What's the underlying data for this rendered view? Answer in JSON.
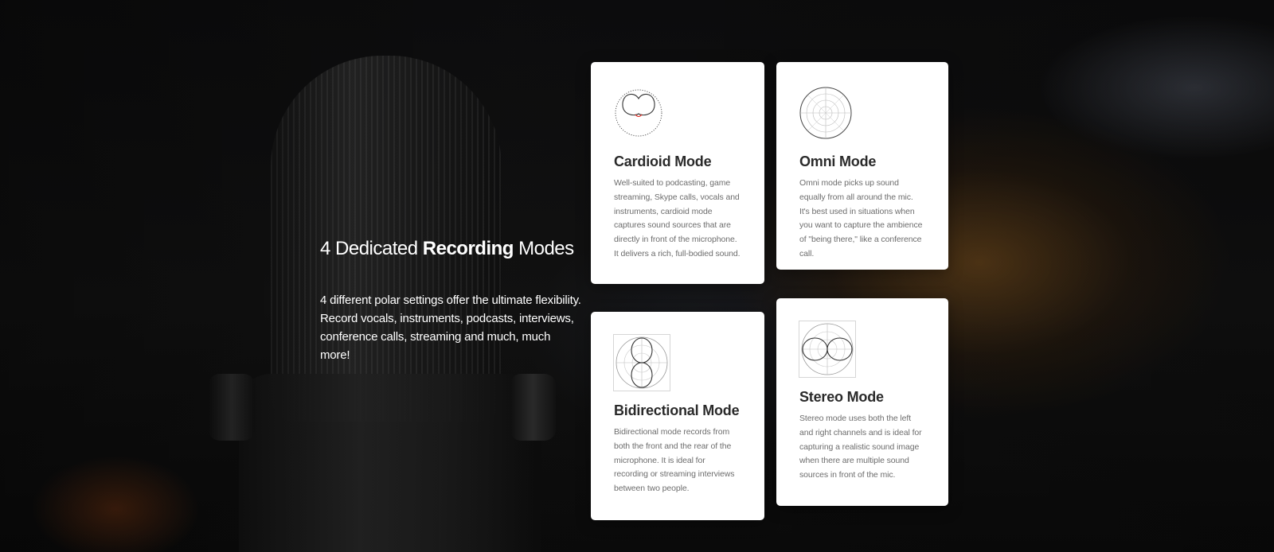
{
  "section": {
    "headline": {
      "before": "4 Dedicated ",
      "highlight": "Recording",
      "after": " Modes"
    },
    "description": "4 different polar settings offer the ultimate flexibility. Record vocals, instruments, podcasts, interviews, conference calls, streaming and much, much more!"
  },
  "colors": {
    "highlight_underline": "#e1251b",
    "card_background": "#ffffff",
    "card_title": "#2a2a2a",
    "card_text": "#6d6d6d"
  },
  "modes": [
    {
      "icon": "cardioid-polar-pattern-icon",
      "title": "Cardioid Mode",
      "text": "Well-suited to podcasting, game streaming, Skype calls, vocals and instruments, cardioid mode captures sound sources that are directly in front of the microphone. It delivers a rich, full-bodied sound."
    },
    {
      "icon": "omni-polar-pattern-icon",
      "title": "Omni Mode",
      "text": "Omni mode picks up sound equally from all around the mic. It's best used in situations when you want to capture the ambience of \"being there,\" like a conference call."
    },
    {
      "icon": "bidirectional-polar-pattern-icon",
      "title": "Bidirectional Mode",
      "text": "Bidirectional mode records from both the front and the rear of the microphone. It is ideal for recording or streaming interviews between two people."
    },
    {
      "icon": "stereo-polar-pattern-icon",
      "title": "Stereo Mode",
      "text": "Stereo mode uses both the left and right channels and is ideal for capturing a realistic sound image when there are multiple sound sources in front of the mic."
    }
  ]
}
